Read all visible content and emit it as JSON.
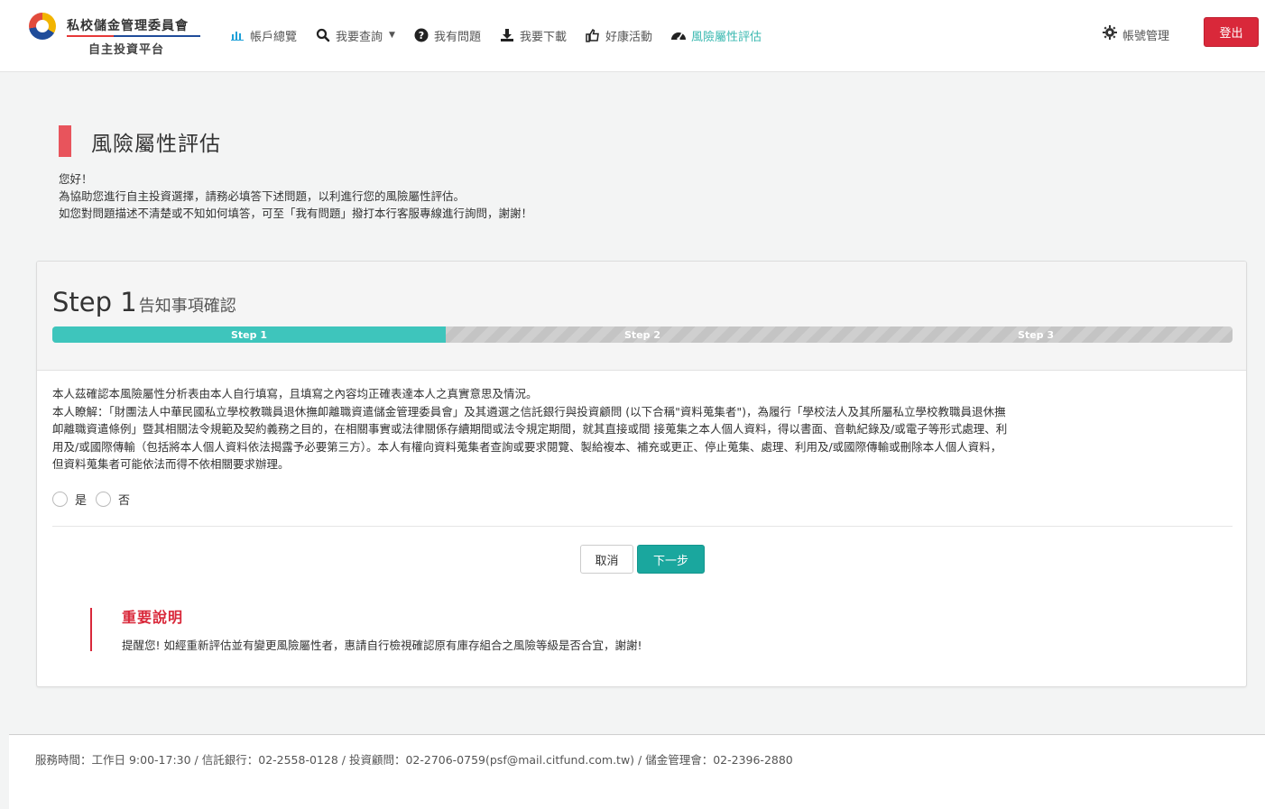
{
  "header": {
    "logo_title": "私校儲金管理委員會",
    "logo_subtitle": "自主投資平台",
    "nav": [
      {
        "label": "帳戶總覽",
        "icon": "bar-chart-icon"
      },
      {
        "label": "我要查詢",
        "icon": "search-icon",
        "dropdown": true
      },
      {
        "label": "我有問題",
        "icon": "question-icon"
      },
      {
        "label": "我要下載",
        "icon": "download-icon"
      },
      {
        "label": "好康活動",
        "icon": "thumbs-up-icon"
      },
      {
        "label": "風險屬性評估",
        "icon": "dashboard-icon",
        "active": true
      }
    ],
    "account_label": "帳號管理",
    "logout_label": "登出"
  },
  "page": {
    "title": "風險屬性評估",
    "intro": [
      "您好！",
      "為協助您進行自主投資選擇，請務必填答下述問題，以利進行您的風險屬性評估。",
      "如您對問題描述不清楚或不知如何填答，可至「我有問題」撥打本行客服專線進行詢問，謝謝！"
    ]
  },
  "step": {
    "number_label": "Step 1",
    "name": "告知事項確認",
    "progress": [
      "Step 1",
      "Step 2",
      "Step 3"
    ],
    "progress_completed": 1,
    "body": [
      "本人茲確認本風險屬性分析表由本人自行填寫，且填寫之內容均正確表達本人之真實意思及情況。",
      "本人瞭解：「財團法人中華民國私立學校教職員退休撫卹離職資遣儲金管理委員會」及其遴選之信託銀行與投資顧問 (以下合稱\"資料蒐集者\")，為履行「學校法人及其所屬私立學校教職員退休撫",
      "卹離職資遣條例」暨其相關法令規範及契約義務之目的，在相關事實或法律關係存續期間或法令規定期間，就其直接或間 接蒐集之本人個人資料，得以書面、音軌紀錄及/或電子等形式處理、利",
      "用及/或國際傳輸（包括將本人個人資料依法揭露予必要第三方）。本人有權向資料蒐集者查詢或要求閱覽、製給複本、補充或更正、停止蒐集、處理、利用及/或國際傳輸或刪除本人個人資料，",
      "但資料蒐集者可能依法而得不依相關要求辦理。"
    ],
    "options": [
      "是",
      "否"
    ],
    "cancel_label": "取消",
    "next_label": "下一步",
    "notice_title": "重要說明",
    "notice_text": "提醒您! 如經重新評估並有變更風險屬性者，惠請自行檢視確認原有庫存組合之風險等級是否合宜，謝謝!"
  },
  "footer": {
    "text": "服務時間：工作日 9:00-17:30 / 信託銀行：02-2558-0128 / 投資顧問：02-2706-0759(psf@mail.citfund.com.tw) / 儲金管理會：02-2396-2880"
  },
  "colors": {
    "accent": "#3ec5bc",
    "primary_button": "#1aa79e",
    "danger": "#d9283a",
    "title_bar": "#e8545c"
  }
}
